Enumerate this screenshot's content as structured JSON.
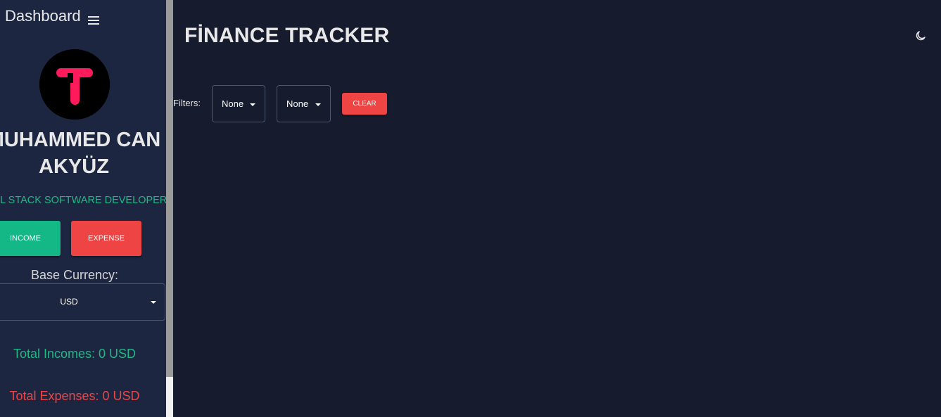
{
  "sidebar": {
    "title": "Dashboard",
    "menu_icon": "hamburger-menu-icon",
    "profile": {
      "name": "MUHAMMED CAN AKYÜZ",
      "role": "FULL STACK SOFTWARE DEVELOPER",
      "avatar_icon": "t-letter-logo"
    },
    "buttons": {
      "income_label": "INCOME",
      "expense_label": "EXPENSE"
    },
    "currency": {
      "label": "Base Currency:",
      "value": "USD"
    },
    "totals": {
      "incomes": "Total Incomes: 0 USD",
      "expenses": "Total Expenses: 0 USD"
    }
  },
  "main": {
    "title": "FİNANCE TRACKER",
    "theme_icon": "moon-icon",
    "filters": {
      "label": "Filters:",
      "filter1": "None",
      "filter2": "None",
      "clear_label": "CLEAR"
    }
  },
  "colors": {
    "background": "#161b2e",
    "sidebar": "#1c2640",
    "income": "#13b886",
    "expense": "#ef4444",
    "logo": "#ff1a5c"
  }
}
